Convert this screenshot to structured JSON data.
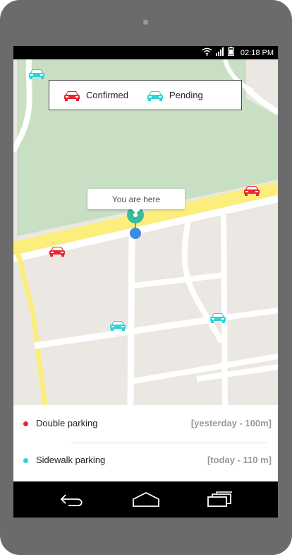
{
  "status_bar": {
    "time": "02:18 PM",
    "icons": [
      "wifi-icon",
      "signal-icon",
      "battery-icon"
    ]
  },
  "legend": {
    "confirmed_label": "Confirmed",
    "pending_label": "Pending"
  },
  "map": {
    "location_tooltip": "You are here"
  },
  "colors": {
    "confirmed": "#e8262d",
    "pending": "#2ed3d6",
    "pin": "#3dbb9a",
    "you_dot": "#3b8ede",
    "road_major": "#fbee7d",
    "park": "#c8dfc4"
  },
  "reports": [
    {
      "title": "Double parking",
      "meta": "[yesterday - 100m]",
      "status": "confirmed"
    },
    {
      "title": "Sidewalk parking",
      "meta": "[today - 110 m]",
      "status": "pending"
    }
  ],
  "nav": {
    "icons": [
      "back-icon",
      "home-icon",
      "recent-apps-icon"
    ]
  }
}
